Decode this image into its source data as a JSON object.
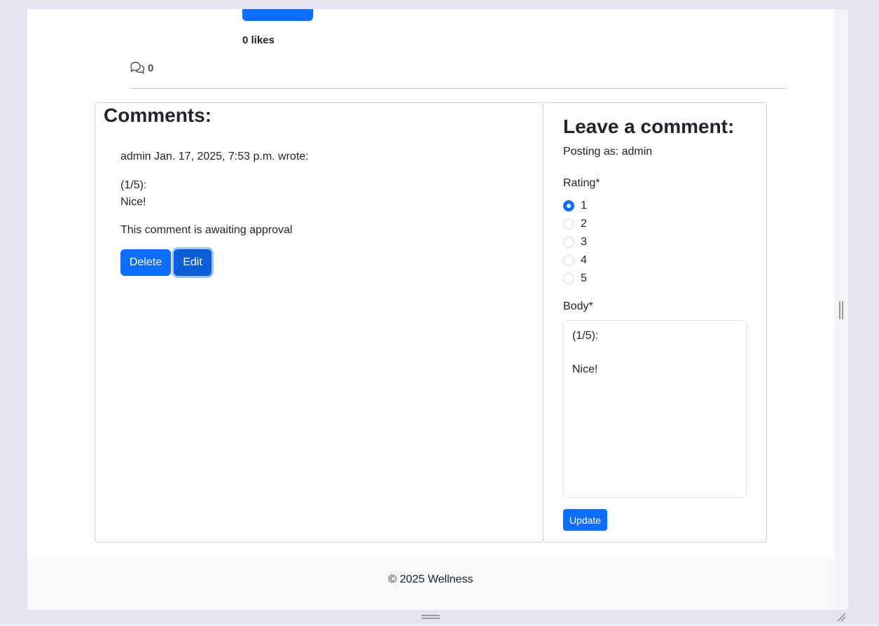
{
  "post": {
    "likes_label": "0 likes",
    "comment_count": "0"
  },
  "comments": {
    "title": "Comments:",
    "items": [
      {
        "author_line": "admin Jan. 17, 2025, 7:53 p.m. wrote:",
        "rating": "(1/5):",
        "body": "Nice!",
        "status": "This comment is awaiting approval",
        "delete_label": "Delete",
        "edit_label": "Edit"
      }
    ]
  },
  "form": {
    "title": "Leave a comment:",
    "posting_as": "Posting as: admin",
    "rating_label": "Rating*",
    "rating_options": [
      "1",
      "2",
      "3",
      "4",
      "5"
    ],
    "selected_rating": "1",
    "body_label": "Body*",
    "body_value": "(1/5):\n\nNice!",
    "submit_label": "Update"
  },
  "footer": {
    "copyright": "© 2025 Wellness"
  },
  "colors": {
    "primary": "#0d6efd",
    "primary_active": "#0b5ed7",
    "footer_bg": "#f7f8fa"
  }
}
